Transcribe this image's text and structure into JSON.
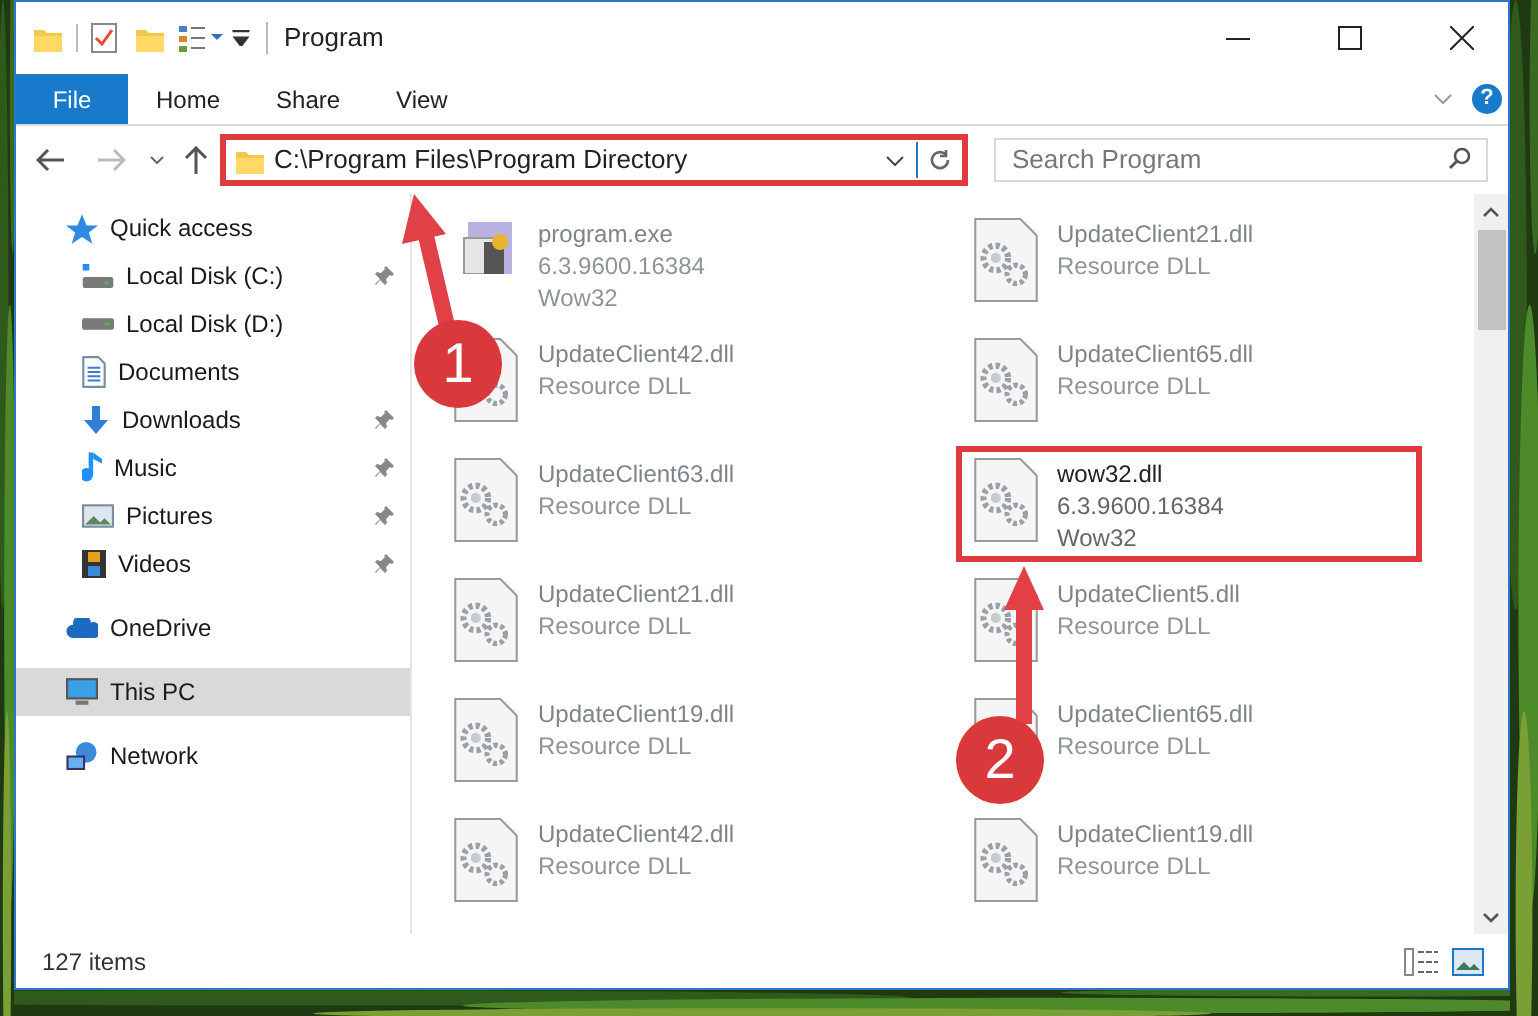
{
  "window": {
    "title": "Program",
    "help": "?"
  },
  "ribbon_tabs": [
    {
      "label": "File",
      "kind": "file"
    },
    {
      "label": "Home",
      "kind": "tab"
    },
    {
      "label": "Share",
      "kind": "tab"
    },
    {
      "label": "View",
      "kind": "tab"
    }
  ],
  "address": {
    "path": "C:\\Program Files\\Program Directory",
    "highlighted": true
  },
  "search": {
    "placeholder": "Search Program"
  },
  "sidebar": {
    "items": [
      {
        "label": "Quick access",
        "kind": "star",
        "selected": false,
        "children": [
          {
            "label": "Local Disk (C:)",
            "kind": "drive-c",
            "pinned": true,
            "selected": false
          },
          {
            "label": "Local Disk (D:)",
            "kind": "drive",
            "pinned": false,
            "selected": false
          },
          {
            "label": "Documents",
            "kind": "documents",
            "pinned": false,
            "selected": false
          },
          {
            "label": "Downloads",
            "kind": "downloads",
            "pinned": true,
            "selected": false
          },
          {
            "label": "Music",
            "kind": "music",
            "pinned": true,
            "selected": false
          },
          {
            "label": "Pictures",
            "kind": "pictures",
            "pinned": true,
            "selected": false
          },
          {
            "label": "Videos",
            "kind": "videos",
            "pinned": true,
            "selected": false
          }
        ]
      },
      {
        "label": "OneDrive",
        "kind": "cloud",
        "selected": false
      },
      {
        "label": "This PC",
        "kind": "pc",
        "selected": true
      },
      {
        "label": "Network",
        "kind": "network",
        "selected": false
      }
    ]
  },
  "files": [
    {
      "name": "program.exe",
      "kind": "exe",
      "details": [
        "6.3.9600.16384",
        "Wow32"
      ],
      "blurred": true,
      "highlighted": false
    },
    {
      "name": "UpdateClient21.dll",
      "kind": "dll",
      "details": [
        "Resource DLL"
      ],
      "blurred": true,
      "highlighted": false
    },
    {
      "name": "UpdateClient42.dll",
      "kind": "dll",
      "details": [
        "Resource DLL"
      ],
      "blurred": true,
      "highlighted": false
    },
    {
      "name": "UpdateClient65.dll",
      "kind": "dll",
      "details": [
        "Resource DLL"
      ],
      "blurred": true,
      "highlighted": false
    },
    {
      "name": "UpdateClient63.dll",
      "kind": "dll",
      "details": [
        "Resource DLL"
      ],
      "blurred": true,
      "highlighted": false
    },
    {
      "name": "wow32.dll",
      "kind": "dll",
      "details": [
        "6.3.9600.16384",
        "Wow32"
      ],
      "blurred": false,
      "highlighted": true
    },
    {
      "name": "UpdateClient21.dll",
      "kind": "dll",
      "details": [
        "Resource DLL"
      ],
      "blurred": true,
      "highlighted": false
    },
    {
      "name": "UpdateClient5.dll",
      "kind": "dll",
      "details": [
        "Resource DLL"
      ],
      "blurred": true,
      "highlighted": false
    },
    {
      "name": "UpdateClient19.dll",
      "kind": "dll",
      "details": [
        "Resource DLL"
      ],
      "blurred": true,
      "highlighted": false
    },
    {
      "name": "UpdateClient65.dll",
      "kind": "dll",
      "details": [
        "Resource DLL"
      ],
      "blurred": true,
      "highlighted": false
    },
    {
      "name": "UpdateClient42.dll",
      "kind": "dll",
      "details": [
        "Resource DLL"
      ],
      "blurred": true,
      "highlighted": false
    },
    {
      "name": "UpdateClient19.dll",
      "kind": "dll",
      "details": [
        "Resource DLL"
      ],
      "blurred": true,
      "highlighted": false
    }
  ],
  "status_bar": {
    "item_count": "127 items"
  },
  "annotations": [
    {
      "number": "1"
    },
    {
      "number": "2"
    }
  ]
}
